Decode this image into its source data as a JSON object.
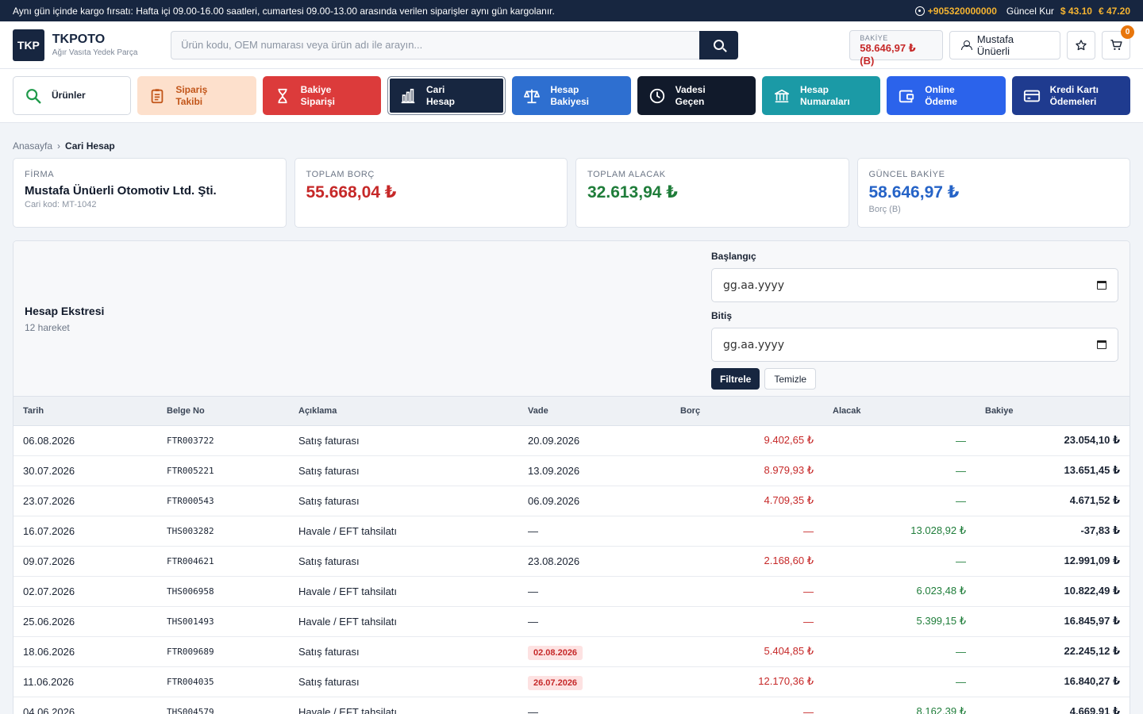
{
  "topbar": {
    "notice": "Aynı gün içinde kargo fırsatı: Hafta içi 09.00-16.00 saatleri, cumartesi 09.00-13.00 arasında verilen siparişler aynı gün kargolanır.",
    "phone": "+905320000000",
    "rate_label": "Güncel Kur",
    "usd": "$ 43.10",
    "eur": "€ 47.20"
  },
  "header": {
    "logo": "TKP",
    "brand": "TKPOTO",
    "tagline": "Ağır Vasıta Yedek Parça",
    "search_placeholder": "Ürün kodu, OEM numarası veya ürün adı ile arayın...",
    "balance_label": "BAKİYE",
    "balance_value": "58.646,97 ₺ (B)",
    "user_name": "Mustafa Ünüerli",
    "cart_count": "0"
  },
  "nav": [
    {
      "line1": "Ürünler",
      "line2": ""
    },
    {
      "line1": "Sipariş",
      "line2": "Takibi"
    },
    {
      "line1": "Bakiye",
      "line2": "Siparişi"
    },
    {
      "line1": "Cari",
      "line2": "Hesap"
    },
    {
      "line1": "Hesap",
      "line2": "Bakiyesi"
    },
    {
      "line1": "Vadesi",
      "line2": "Geçen"
    },
    {
      "line1": "Hesap",
      "line2": "Numaraları"
    },
    {
      "line1": "Online",
      "line2": "Ödeme"
    },
    {
      "line1": "Kredi Kartı",
      "line2": "Ödemeleri"
    }
  ],
  "breadcrumb": {
    "home": "Anasayfa",
    "sep": "›",
    "current": "Cari Hesap"
  },
  "cards": {
    "firm": {
      "label": "FİRMA",
      "name": "Mustafa Ünüerli Otomotiv Ltd. Şti.",
      "sub": "Cari kod: MT-1042"
    },
    "debt": {
      "label": "TOPLAM BORÇ",
      "value": "55.668,04 ₺"
    },
    "credit": {
      "label": "TOPLAM ALACAK",
      "value": "32.613,94 ₺"
    },
    "balance": {
      "label": "GÜNCEL BAKİYE",
      "value": "58.646,97 ₺",
      "sub": "Borç (B)"
    }
  },
  "statement": {
    "title": "Hesap Ekstresi",
    "count": "12 hareket",
    "start_label": "Başlangıç",
    "end_label": "Bitiş",
    "date_placeholder": "gg.aa.yyyy",
    "filter_btn": "Filtrele",
    "clear_btn": "Temizle",
    "columns": [
      "Tarih",
      "Belge No",
      "Açıklama",
      "Vade",
      "Borç",
      "Alacak",
      "Bakiye"
    ],
    "rows": [
      {
        "date": "06.08.2026",
        "doc": "FTR003722",
        "desc": "Satış faturası",
        "due": "20.09.2026",
        "overdue": false,
        "debt": "9.402,65 ₺",
        "credit": "—",
        "bal": "23.054,10 ₺"
      },
      {
        "date": "30.07.2026",
        "doc": "FTR005221",
        "desc": "Satış faturası",
        "due": "13.09.2026",
        "overdue": false,
        "debt": "8.979,93 ₺",
        "credit": "—",
        "bal": "13.651,45 ₺"
      },
      {
        "date": "23.07.2026",
        "doc": "FTR000543",
        "desc": "Satış faturası",
        "due": "06.09.2026",
        "overdue": false,
        "debt": "4.709,35 ₺",
        "credit": "—",
        "bal": "4.671,52 ₺"
      },
      {
        "date": "16.07.2026",
        "doc": "THS003282",
        "desc": "Havale / EFT tahsilatı",
        "due": "—",
        "overdue": false,
        "debt": "—",
        "credit": "13.028,92 ₺",
        "bal": "-37,83 ₺"
      },
      {
        "date": "09.07.2026",
        "doc": "FTR004621",
        "desc": "Satış faturası",
        "due": "23.08.2026",
        "overdue": false,
        "debt": "2.168,60 ₺",
        "credit": "—",
        "bal": "12.991,09 ₺"
      },
      {
        "date": "02.07.2026",
        "doc": "THS006958",
        "desc": "Havale / EFT tahsilatı",
        "due": "—",
        "overdue": false,
        "debt": "—",
        "credit": "6.023,48 ₺",
        "bal": "10.822,49 ₺"
      },
      {
        "date": "25.06.2026",
        "doc": "THS001493",
        "desc": "Havale / EFT tahsilatı",
        "due": "—",
        "overdue": false,
        "debt": "—",
        "credit": "5.399,15 ₺",
        "bal": "16.845,97 ₺"
      },
      {
        "date": "18.06.2026",
        "doc": "FTR009689",
        "desc": "Satış faturası",
        "due": "02.08.2026",
        "overdue": true,
        "debt": "5.404,85 ₺",
        "credit": "—",
        "bal": "22.245,12 ₺"
      },
      {
        "date": "11.06.2026",
        "doc": "FTR004035",
        "desc": "Satış faturası",
        "due": "26.07.2026",
        "overdue": true,
        "debt": "12.170,36 ₺",
        "credit": "—",
        "bal": "16.840,27 ₺"
      },
      {
        "date": "04.06.2026",
        "doc": "THS004579",
        "desc": "Havale / EFT tahsilatı",
        "due": "—",
        "overdue": false,
        "debt": "—",
        "credit": "8.162,39 ₺",
        "bal": "4.669,91 ₺"
      }
    ]
  }
}
